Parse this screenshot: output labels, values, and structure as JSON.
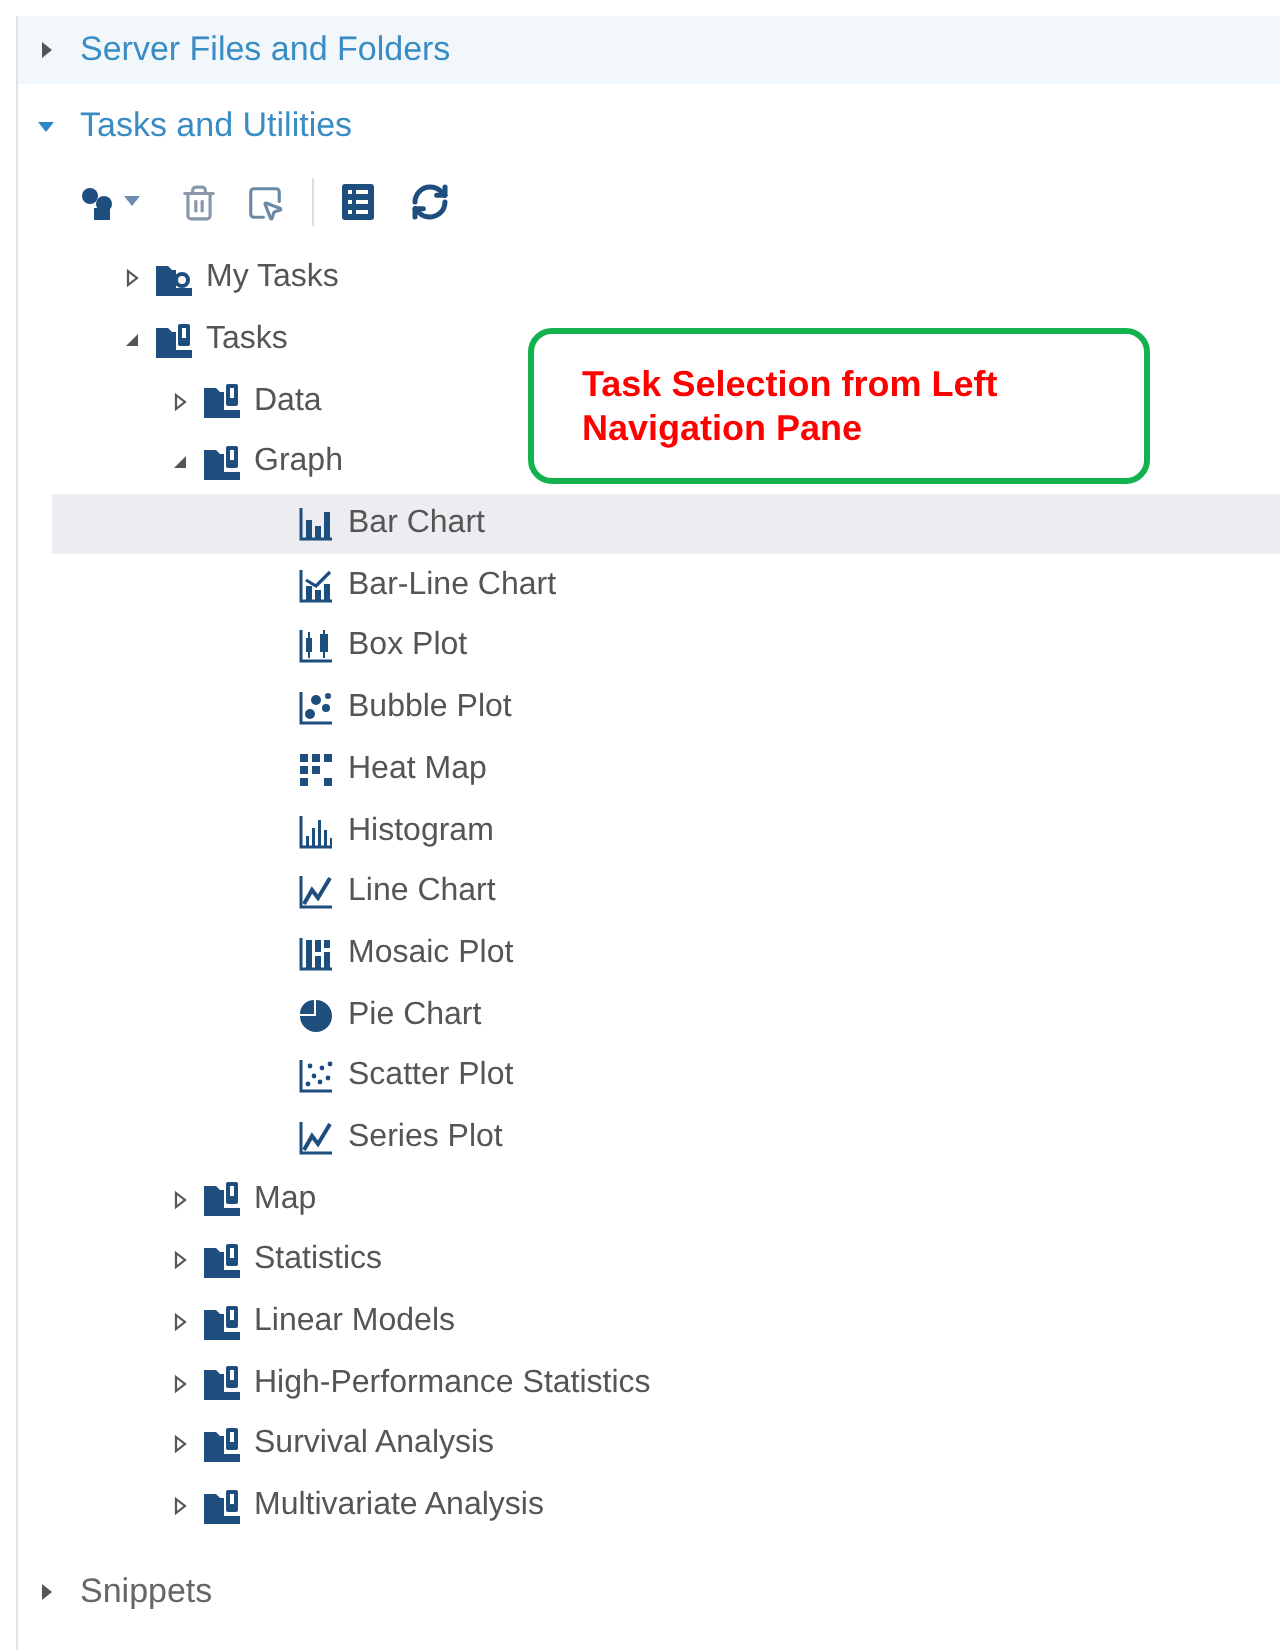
{
  "sections": [
    {
      "title": "Server Files and Folders",
      "expanded": false,
      "highlighted": true,
      "dimmed": false
    },
    {
      "title": "Tasks and Utilities",
      "expanded": true,
      "highlighted": false,
      "dimmed": false
    },
    {
      "title": "Snippets",
      "expanded": false,
      "highlighted": false,
      "dimmed": true
    }
  ],
  "tree": [
    {
      "label": "My Tasks",
      "kind": "user-folder",
      "expanded": false,
      "selected": false
    },
    {
      "label": "Tasks",
      "kind": "folder",
      "expanded": true,
      "selected": false,
      "children": [
        {
          "label": "Data",
          "kind": "folder",
          "expanded": false,
          "selected": false
        },
        {
          "label": "Graph",
          "kind": "folder",
          "expanded": true,
          "selected": false,
          "children": [
            {
              "label": "Bar Chart",
              "kind": "task",
              "selected": true
            },
            {
              "label": "Bar-Line Chart",
              "kind": "task",
              "selected": false
            },
            {
              "label": "Box Plot",
              "kind": "task",
              "selected": false
            },
            {
              "label": "Bubble Plot",
              "kind": "task",
              "selected": false
            },
            {
              "label": "Heat Map",
              "kind": "task",
              "selected": false
            },
            {
              "label": "Histogram",
              "kind": "task",
              "selected": false
            },
            {
              "label": "Line Chart",
              "kind": "task",
              "selected": false
            },
            {
              "label": "Mosaic Plot",
              "kind": "task",
              "selected": false
            },
            {
              "label": "Pie Chart",
              "kind": "task",
              "selected": false
            },
            {
              "label": "Scatter Plot",
              "kind": "task",
              "selected": false
            },
            {
              "label": "Series Plot",
              "kind": "task",
              "selected": false
            }
          ]
        },
        {
          "label": "Map",
          "kind": "folder",
          "expanded": false,
          "selected": false
        },
        {
          "label": "Statistics",
          "kind": "folder",
          "expanded": false,
          "selected": false
        },
        {
          "label": "Linear Models",
          "kind": "folder",
          "expanded": false,
          "selected": false
        },
        {
          "label": "High-Performance Statistics",
          "kind": "folder",
          "expanded": false,
          "selected": false
        },
        {
          "label": "Survival Analysis",
          "kind": "folder",
          "expanded": false,
          "selected": false
        },
        {
          "label": "Multivariate Analysis",
          "kind": "folder",
          "expanded": false,
          "selected": false
        }
      ]
    }
  ],
  "callout": {
    "text": "Task Selection from Left Navigation Pane"
  }
}
